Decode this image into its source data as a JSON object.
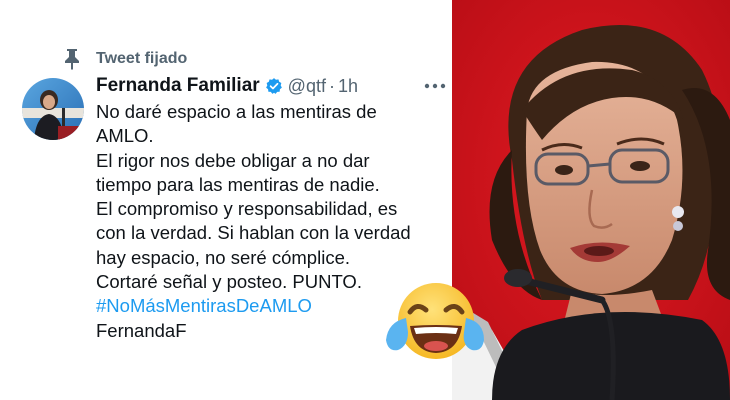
{
  "tweet": {
    "pinned_label": "Tweet fijado",
    "display_name": "Fernanda Familiar",
    "handle": "@qtf",
    "separator": "·",
    "time": "1h",
    "lines": [
      "No daré espacio a las mentiras de",
      "AMLO.",
      "El rigor nos debe obligar a no dar",
      "tiempo para las mentiras de nadie.",
      "El compromiso y responsabilidad, es",
      "con la verdad. Si hablan con la verdad",
      "hay espacio, no seré cómplice.",
      "Cortaré señal y posteo. PUNTO."
    ],
    "hashtag": "#NoMásMentirasDeAMLO",
    "signature": "FernandaF"
  },
  "icons": {
    "pin": "pin-icon",
    "verified": "verified-badge-icon",
    "more": "more-options-icon",
    "emoji": "face-with-tears-of-joy-emoji"
  },
  "colors": {
    "hashtag": "#1d9bf0",
    "verified": "#1d9bf0",
    "secondary_text": "#536471",
    "primary_text": "#0f1419",
    "photo_background": "#d5111c"
  }
}
